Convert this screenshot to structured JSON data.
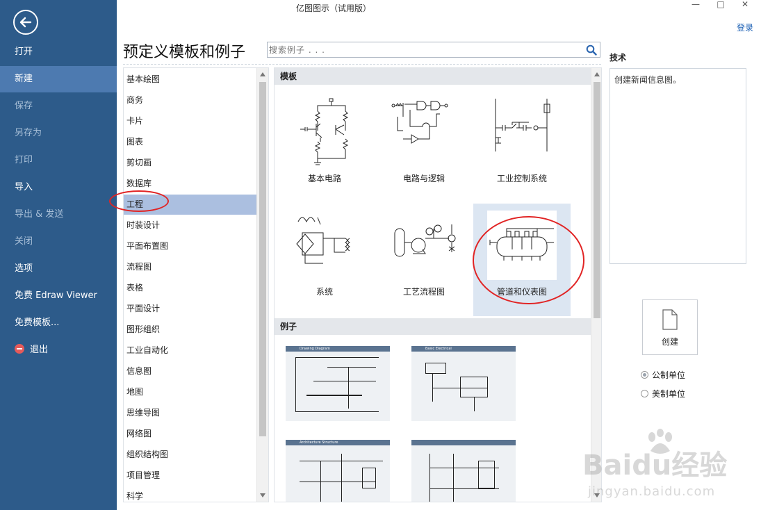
{
  "app": {
    "title": "亿图图示（试用版）",
    "login": "登录"
  },
  "window": {
    "minimize": "—",
    "maximize": "□",
    "close": "✕"
  },
  "sidebar": {
    "items": [
      {
        "label": "打开",
        "state": "normal"
      },
      {
        "label": "新建",
        "state": "active"
      },
      {
        "label": "保存",
        "state": "disabled"
      },
      {
        "label": "另存为",
        "state": "disabled"
      },
      {
        "label": "打印",
        "state": "disabled"
      },
      {
        "label": "导入",
        "state": "normal"
      },
      {
        "label": "导出 & 发送",
        "state": "disabled"
      },
      {
        "label": "关闭",
        "state": "disabled"
      },
      {
        "label": "选项",
        "state": "normal"
      },
      {
        "label": "免费 Edraw Viewer",
        "state": "normal"
      },
      {
        "label": "免费模板...",
        "state": "normal"
      }
    ],
    "exit": "退出"
  },
  "main": {
    "title": "预定义模板和例子",
    "search_placeholder": "搜索例子 . . ."
  },
  "categories": [
    "基本绘图",
    "商务",
    "卡片",
    "图表",
    "剪切画",
    "数据库",
    "工程",
    "时装设计",
    "平面布置图",
    "流程图",
    "表格",
    "平面设计",
    "图形组织",
    "工业自动化",
    "信息图",
    "地图",
    "思维导图",
    "网络图",
    "组织结构图",
    "项目管理",
    "科学"
  ],
  "selected_category": "工程",
  "templates": {
    "header": "模板",
    "items": [
      {
        "label": "基本电路"
      },
      {
        "label": "电路与逻辑"
      },
      {
        "label": "工业控制系统"
      },
      {
        "label": "系统"
      },
      {
        "label": "工艺流程图"
      },
      {
        "label": "管道和仪表图"
      }
    ],
    "selected": "管道和仪表图"
  },
  "examples": {
    "header": "例子",
    "items": [
      {
        "banner": "Drawing Diagram"
      },
      {
        "banner": "Basic Electrical"
      },
      {
        "banner": "Architecture Structure"
      },
      {
        "banner": ""
      }
    ]
  },
  "details": {
    "heading": "技术",
    "description": "创建新闻信息图。",
    "create": "创建",
    "units": [
      {
        "label": "公制单位",
        "checked": true
      },
      {
        "label": "美制单位",
        "checked": false
      }
    ]
  },
  "watermark": {
    "logo": "Baidu经验",
    "url": "jingyan.baidu.com"
  },
  "colors": {
    "sidebar": "#2d5b8a",
    "sidebar_active": "#4d7ab0",
    "selected_category": "#abbfe0",
    "selected_tile": "#dce6f2",
    "annotation": "#e12424",
    "link": "#1a5fb4"
  }
}
